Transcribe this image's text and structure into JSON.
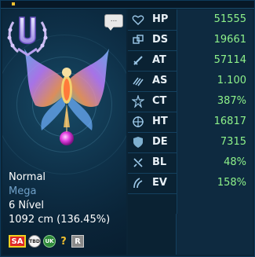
{
  "window": {
    "accent_color": "#f0c030"
  },
  "character": {
    "rank_letter": "U",
    "rank_icon": "rank-u-wreath-icon",
    "chat_icon": "speech-bubble-icon",
    "chat_text": "...",
    "type": "Normal",
    "subtype": "Mega",
    "level_text": "6 Nível",
    "size_text": "1092 cm (136.45%)"
  },
  "flags": [
    {
      "label": "SA",
      "icon": "sa-badge-icon"
    },
    {
      "label": "TBD",
      "icon": "tbd-badge-icon"
    },
    {
      "label": "UK",
      "icon": "uk-badge-icon"
    },
    {
      "label": "?",
      "icon": "question-badge-icon"
    },
    {
      "label": "R",
      "icon": "r-badge-icon"
    }
  ],
  "stats": [
    {
      "label": "HP",
      "value": "51555",
      "icon": "heart-icon"
    },
    {
      "label": "DS",
      "value": "19661",
      "icon": "digisoul-icon"
    },
    {
      "label": "AT",
      "value": "57114",
      "icon": "sword-icon"
    },
    {
      "label": "AS",
      "value": "1.100",
      "icon": "attack-speed-icon"
    },
    {
      "label": "CT",
      "value": "387%",
      "icon": "critical-icon"
    },
    {
      "label": "HT",
      "value": "16817",
      "icon": "crosshair-icon"
    },
    {
      "label": "DE",
      "value": "7315",
      "icon": "shield-icon"
    },
    {
      "label": "BL",
      "value": "48%",
      "icon": "block-icon"
    },
    {
      "label": "EV",
      "value": "158%",
      "icon": "evade-icon"
    }
  ]
}
